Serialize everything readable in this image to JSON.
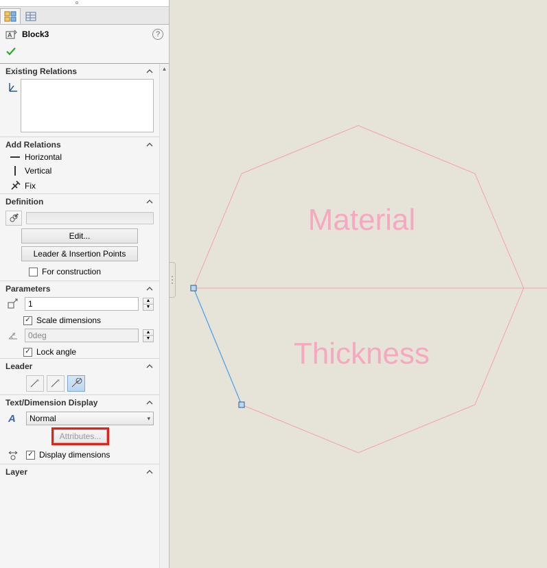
{
  "header": {
    "block_name": "Block3"
  },
  "sections": {
    "existing_relations": "Existing Relations",
    "add_relations": {
      "title": "Add Relations",
      "horizontal": "Horizontal",
      "vertical": "Vertical",
      "fix": "Fix"
    },
    "definition": {
      "title": "Definition",
      "edit_btn": "Edit...",
      "leader_btn": "Leader & Insertion Points",
      "for_construction": "For construction"
    },
    "parameters": {
      "title": "Parameters",
      "scale_value": "1",
      "scale_dimensions": "Scale dimensions",
      "angle_value": "0deg",
      "lock_angle": "Lock angle"
    },
    "leader": {
      "title": "Leader"
    },
    "tdd": {
      "title": "Text/Dimension Display",
      "select_value": "Normal",
      "attributes_btn": "Attributes...",
      "display_dimensions": "Display dimensions"
    },
    "layer": {
      "title": "Layer"
    }
  },
  "canvas": {
    "label_material": "Material",
    "label_thickness": "Thickness"
  }
}
